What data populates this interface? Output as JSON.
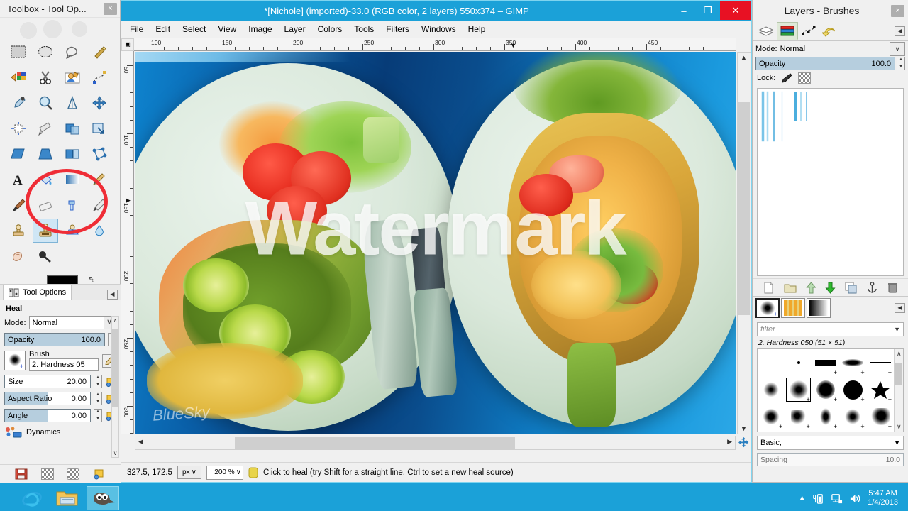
{
  "toolbox": {
    "window_title": "Toolbox - Tool Op...",
    "close_label": "×",
    "tools": [
      {
        "name": "rect-select-tool",
        "label": "Rectangle Select"
      },
      {
        "name": "ellipse-select-tool",
        "label": "Ellipse Select"
      },
      {
        "name": "free-select-tool",
        "label": "Free Select"
      },
      {
        "name": "fuzzy-select-tool",
        "label": "Fuzzy Select"
      },
      {
        "name": "select-by-color-tool",
        "label": "Select by Color"
      },
      {
        "name": "scissors-select-tool",
        "label": "Scissors Select"
      },
      {
        "name": "foreground-select-tool",
        "label": "Foreground Select"
      },
      {
        "name": "paths-tool",
        "label": "Paths"
      },
      {
        "name": "color-picker-tool",
        "label": "Color Picker"
      },
      {
        "name": "zoom-tool",
        "label": "Zoom"
      },
      {
        "name": "measure-tool",
        "label": "Measure"
      },
      {
        "name": "move-tool",
        "label": "Move"
      },
      {
        "name": "align-tool",
        "label": "Alignment"
      },
      {
        "name": "crop-tool",
        "label": "Crop"
      },
      {
        "name": "rotate-tool",
        "label": "Rotate"
      },
      {
        "name": "scale-tool",
        "label": "Scale"
      },
      {
        "name": "shear-tool",
        "label": "Shear"
      },
      {
        "name": "perspective-tool",
        "label": "Perspective"
      },
      {
        "name": "flip-tool",
        "label": "Flip"
      },
      {
        "name": "cage-transform-tool",
        "label": "Cage Transform"
      },
      {
        "name": "text-tool",
        "label": "Text"
      },
      {
        "name": "bucket-fill-tool",
        "label": "Bucket Fill"
      },
      {
        "name": "blend-tool",
        "label": "Blend"
      },
      {
        "name": "pencil-tool",
        "label": "Pencil"
      },
      {
        "name": "paintbrush-tool",
        "label": "Paintbrush"
      },
      {
        "name": "eraser-tool",
        "label": "Eraser"
      },
      {
        "name": "airbrush-tool",
        "label": "Airbrush"
      },
      {
        "name": "ink-tool",
        "label": "Ink"
      },
      {
        "name": "clone-tool",
        "label": "Clone"
      },
      {
        "name": "heal-tool",
        "label": "Heal"
      },
      {
        "name": "perspective-clone-tool",
        "label": "Perspective Clone"
      },
      {
        "name": "blur-sharpen-tool",
        "label": "Blur / Sharpen"
      },
      {
        "name": "smudge-tool",
        "label": "Smudge"
      },
      {
        "name": "dodge-burn-tool",
        "label": "Dodge / Burn"
      }
    ],
    "selected_tool": "heal-tool",
    "highlighted_tool": "heal-tool",
    "foreground_color": "#000000",
    "background_color": "#ffffff"
  },
  "tool_options": {
    "tab_label": "Tool Options",
    "title": "Heal",
    "mode_label": "Mode:",
    "mode_value": "Normal",
    "opacity_label": "Opacity",
    "opacity_value": "100.0",
    "brush_label": "Brush",
    "brush_value": "2. Hardness 05",
    "size_label": "Size",
    "size_value": "20.00",
    "aspect_label": "Aspect Ratio",
    "aspect_value": "0.00",
    "angle_label": "Angle",
    "angle_value": "0.00",
    "dynamics_label": "Dynamics"
  },
  "image_window": {
    "title": "*[Nichole] (imported)-33.0 (RGB color, 2 layers) 550x374 – GIMP",
    "minimize_label": "–",
    "maximize_label": "❐",
    "close_label": "✕",
    "menus": [
      "File",
      "Edit",
      "Select",
      "View",
      "Image",
      "Layer",
      "Colors",
      "Tools",
      "Filters",
      "Windows",
      "Help"
    ],
    "h_ruler_labels": [
      "100",
      "150",
      "200",
      "250",
      "300",
      "350",
      "400",
      "450"
    ],
    "v_ruler_labels": [
      "50",
      "100",
      "150",
      "200",
      "250",
      "300"
    ],
    "canvas": {
      "watermark_text": "Watermark",
      "brand_text": "BlueSky"
    },
    "status": {
      "position": "327.5, 172.5",
      "unit": "px",
      "zoom": "200 %",
      "message": "Click to heal (try Shift for a straight line, Ctrl to set a new heal source)"
    }
  },
  "right_dock": {
    "title": "Layers - Brushes",
    "close_label": "×",
    "tabs": [
      {
        "name": "layers-tab",
        "label": "Layers"
      },
      {
        "name": "channels-tab",
        "label": "Channels"
      },
      {
        "name": "paths-tab",
        "label": "Paths"
      },
      {
        "name": "undo-history-tab",
        "label": "Undo History"
      }
    ],
    "selected_tab": "channels-tab",
    "mode_label": "Mode:",
    "mode_value": "Normal",
    "opacity_label": "Opacity",
    "opacity_value": "100.0",
    "lock_label": "Lock:",
    "layer_buttons": [
      {
        "name": "new-layer-button",
        "label": "New Layer"
      },
      {
        "name": "new-layer-group-button",
        "label": "New Layer Group"
      },
      {
        "name": "raise-layer-button",
        "label": "Raise Layer"
      },
      {
        "name": "lower-layer-button",
        "label": "Lower Layer"
      },
      {
        "name": "duplicate-layer-button",
        "label": "Duplicate Layer"
      },
      {
        "name": "anchor-layer-button",
        "label": "Anchor Layer"
      },
      {
        "name": "delete-layer-button",
        "label": "Delete Layer"
      }
    ],
    "brush_tabs": [
      {
        "name": "brushes-tab",
        "label": "Brushes"
      },
      {
        "name": "patterns-tab",
        "label": "Patterns"
      },
      {
        "name": "gradients-tab",
        "label": "Gradients"
      }
    ],
    "selected_brush_tab": "brushes-tab",
    "filter_placeholder": "filter",
    "brush_caption": "2. Hardness 050 (51 × 51)",
    "selected_brush_index": 6,
    "brush_set": "Basic,",
    "spacing_label": "Spacing",
    "spacing_value": "10.0"
  },
  "taskbar": {
    "items": [
      {
        "name": "taskbar-ie",
        "label": "Internet Explorer",
        "active": false
      },
      {
        "name": "taskbar-explorer",
        "label": "File Explorer",
        "active": false
      },
      {
        "name": "taskbar-gimp",
        "label": "GIMP",
        "active": true
      }
    ],
    "clock_time": "5:47 AM",
    "clock_date": "1/4/2013"
  },
  "colors": {
    "accent": "#1ba1d8",
    "close_red": "#e81123",
    "highlight_ring": "#ef2d36",
    "slider_fill": "#b6cede"
  }
}
